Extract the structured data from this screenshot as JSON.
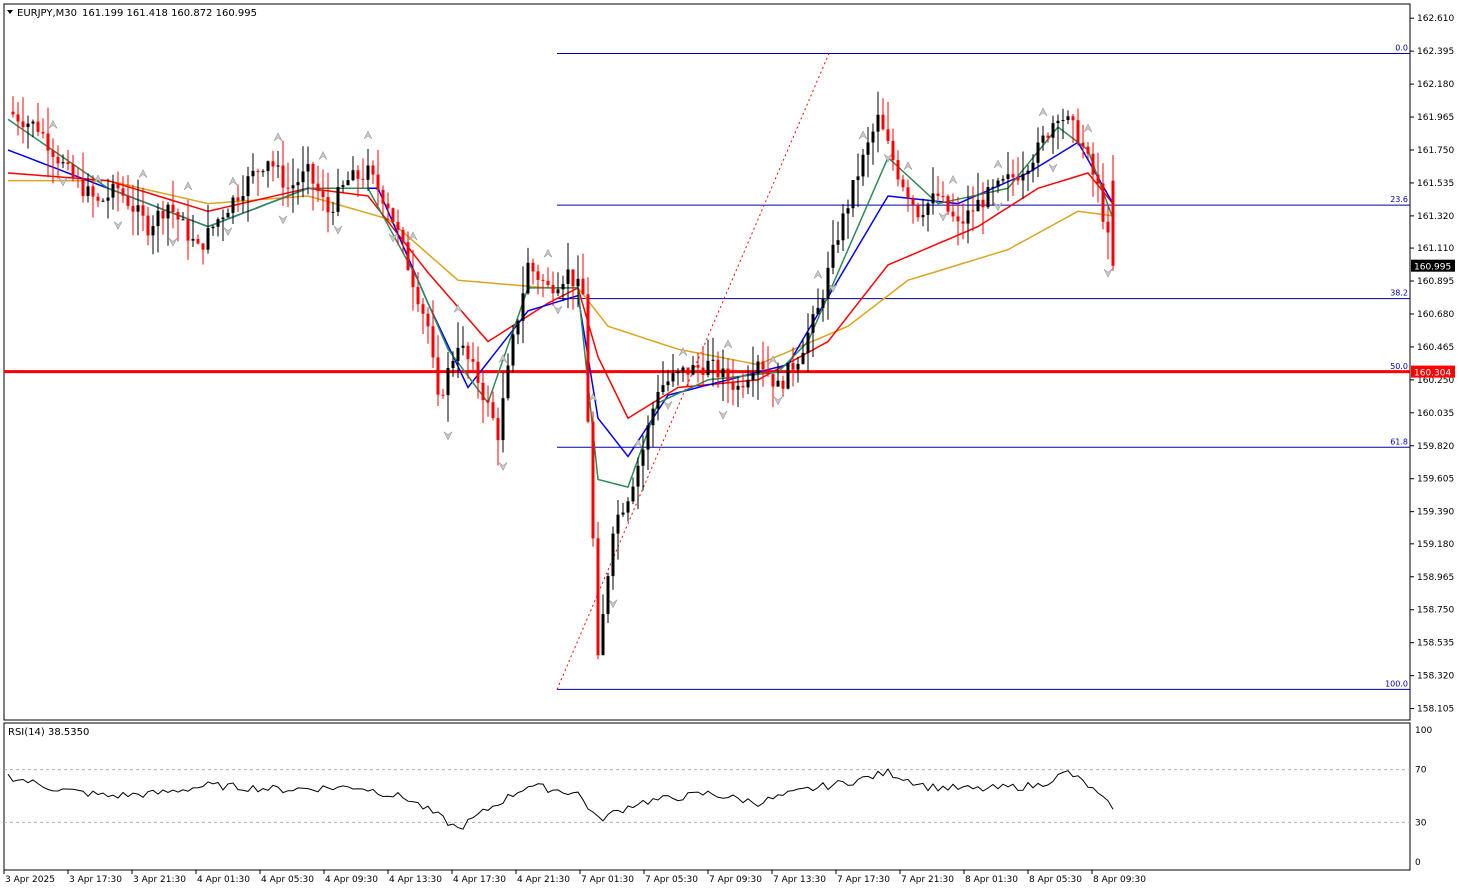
{
  "header": {
    "symbol": "EURJPY,M30",
    "ohlc": "161.199 161.418 160.872 160.995"
  },
  "price_axis": {
    "ticks": [
      "162.610",
      "162.395",
      "162.180",
      "161.965",
      "161.750",
      "161.535",
      "161.320",
      "161.110",
      "160.895",
      "160.680",
      "160.465",
      "160.250",
      "160.035",
      "159.820",
      "159.605",
      "159.390",
      "159.180",
      "158.965",
      "158.750",
      "158.535",
      "158.320",
      "158.105"
    ],
    "current_price_label": "160.995",
    "horizontal_line_label": "160.304"
  },
  "fibonacci": {
    "levels": [
      {
        "label": "0.0",
        "price": 162.38
      },
      {
        "label": "23.6",
        "price": 161.39
      },
      {
        "label": "38.2",
        "price": 160.78
      },
      {
        "label": "50.0",
        "price": 160.3
      },
      {
        "label": "61.8",
        "price": 159.81
      },
      {
        "label": "100.0",
        "price": 158.23
      }
    ]
  },
  "time_axis": {
    "labels": [
      "3 Apr 2025",
      "3 Apr 17:30",
      "3 Apr 21:30",
      "4 Apr 01:30",
      "4 Apr 05:30",
      "4 Apr 09:30",
      "4 Apr 13:30",
      "4 Apr 17:30",
      "4 Apr 21:30",
      "7 Apr 01:30",
      "7 Apr 05:30",
      "7 Apr 09:30",
      "7 Apr 13:30",
      "7 Apr 17:30",
      "7 Apr 21:30",
      "8 Apr 01:30",
      "8 Apr 05:30",
      "8 Apr 09:30"
    ]
  },
  "rsi": {
    "label": "RSI(14) 38.5350",
    "levels": [
      "100",
      "70",
      "30",
      "0"
    ]
  },
  "colors": {
    "bull": "#000000",
    "bear": "#ff0000",
    "ma_fast": "#2e8b57",
    "ma_blue": "#0000ff",
    "ma_red": "#ff0000",
    "ma_gold": "#daa520",
    "fib": "#0000aa",
    "hline": "#ff0000"
  },
  "chart_data": {
    "type": "candlestick",
    "symbol": "EURJPY",
    "timeframe": "M30",
    "ylim": [
      158.05,
      162.72
    ],
    "close_points": [
      [
        0,
        162.0
      ],
      [
        6,
        161.9
      ],
      [
        12,
        161.6
      ],
      [
        18,
        161.4
      ],
      [
        22,
        161.5
      ],
      [
        28,
        161.25
      ],
      [
        32,
        161.4
      ],
      [
        38,
        161.1
      ],
      [
        42,
        161.3
      ],
      [
        48,
        161.55
      ],
      [
        52,
        161.7
      ],
      [
        56,
        161.5
      ],
      [
        60,
        161.6
      ],
      [
        64,
        161.35
      ],
      [
        68,
        161.55
      ],
      [
        72,
        161.6
      ],
      [
        76,
        161.4
      ],
      [
        80,
        161.0
      ],
      [
        84,
        160.6
      ],
      [
        86,
        160.1
      ],
      [
        90,
        160.5
      ],
      [
        94,
        160.25
      ],
      [
        98,
        159.9
      ],
      [
        101,
        160.5
      ],
      [
        104,
        161.0
      ],
      [
        108,
        160.85
      ],
      [
        112,
        160.95
      ],
      [
        115,
        160.8
      ],
      [
        118,
        158.4
      ],
      [
        121,
        159.3
      ],
      [
        124,
        159.5
      ],
      [
        127,
        159.8
      ],
      [
        130,
        160.2
      ],
      [
        135,
        160.3
      ],
      [
        140,
        160.35
      ],
      [
        146,
        160.2
      ],
      [
        150,
        160.4
      ],
      [
        154,
        160.2
      ],
      [
        158,
        160.4
      ],
      [
        162,
        160.7
      ],
      [
        166,
        161.2
      ],
      [
        170,
        161.6
      ],
      [
        174,
        161.95
      ],
      [
        178,
        161.6
      ],
      [
        182,
        161.35
      ],
      [
        186,
        161.45
      ],
      [
        190,
        161.25
      ],
      [
        194,
        161.4
      ],
      [
        198,
        161.5
      ],
      [
        202,
        161.6
      ],
      [
        206,
        161.75
      ],
      [
        210,
        162.0
      ],
      [
        214,
        161.85
      ],
      [
        218,
        161.5
      ],
      [
        221,
        160.99
      ]
    ],
    "ma_fast": [
      [
        0,
        161.95
      ],
      [
        20,
        161.5
      ],
      [
        40,
        161.25
      ],
      [
        60,
        161.5
      ],
      [
        72,
        161.5
      ],
      [
        82,
        160.9
      ],
      [
        88,
        160.45
      ],
      [
        96,
        160.1
      ],
      [
        104,
        160.85
      ],
      [
        114,
        160.85
      ],
      [
        118,
        159.6
      ],
      [
        124,
        159.55
      ],
      [
        130,
        160.1
      ],
      [
        140,
        160.25
      ],
      [
        154,
        160.3
      ],
      [
        160,
        160.5
      ],
      [
        168,
        161.1
      ],
      [
        176,
        161.7
      ],
      [
        186,
        161.4
      ],
      [
        200,
        161.5
      ],
      [
        210,
        161.9
      ],
      [
        216,
        161.75
      ],
      [
        221,
        161.3
      ]
    ],
    "ma_blue": [
      [
        0,
        161.75
      ],
      [
        20,
        161.5
      ],
      [
        40,
        161.25
      ],
      [
        60,
        161.5
      ],
      [
        74,
        161.5
      ],
      [
        84,
        160.75
      ],
      [
        92,
        160.2
      ],
      [
        104,
        160.7
      ],
      [
        114,
        160.8
      ],
      [
        118,
        160.0
      ],
      [
        124,
        159.75
      ],
      [
        132,
        160.15
      ],
      [
        144,
        160.25
      ],
      [
        156,
        160.35
      ],
      [
        166,
        160.9
      ],
      [
        176,
        161.45
      ],
      [
        190,
        161.4
      ],
      [
        204,
        161.6
      ],
      [
        214,
        161.8
      ],
      [
        221,
        161.4
      ]
    ],
    "ma_red": [
      [
        0,
        161.6
      ],
      [
        20,
        161.55
      ],
      [
        40,
        161.35
      ],
      [
        60,
        161.5
      ],
      [
        72,
        161.45
      ],
      [
        84,
        160.95
      ],
      [
        96,
        160.5
      ],
      [
        108,
        160.75
      ],
      [
        114,
        160.85
      ],
      [
        118,
        160.4
      ],
      [
        124,
        160.0
      ],
      [
        134,
        160.2
      ],
      [
        150,
        160.25
      ],
      [
        164,
        160.5
      ],
      [
        176,
        161.0
      ],
      [
        194,
        161.25
      ],
      [
        206,
        161.5
      ],
      [
        216,
        161.6
      ],
      [
        221,
        161.4
      ]
    ],
    "ma_gold": [
      [
        0,
        161.55
      ],
      [
        20,
        161.55
      ],
      [
        40,
        161.4
      ],
      [
        60,
        161.45
      ],
      [
        76,
        161.3
      ],
      [
        90,
        160.9
      ],
      [
        108,
        160.85
      ],
      [
        114,
        160.85
      ],
      [
        120,
        160.6
      ],
      [
        134,
        160.45
      ],
      [
        150,
        160.35
      ],
      [
        168,
        160.6
      ],
      [
        180,
        160.9
      ],
      [
        200,
        161.1
      ],
      [
        214,
        161.35
      ],
      [
        221,
        161.32
      ]
    ],
    "rsi_points": [
      [
        0,
        65
      ],
      [
        10,
        55
      ],
      [
        20,
        50
      ],
      [
        30,
        52
      ],
      [
        40,
        58
      ],
      [
        55,
        55
      ],
      [
        70,
        57
      ],
      [
        80,
        48
      ],
      [
        86,
        35
      ],
      [
        90,
        25
      ],
      [
        96,
        40
      ],
      [
        104,
        58
      ],
      [
        114,
        52
      ],
      [
        118,
        32
      ],
      [
        126,
        45
      ],
      [
        140,
        52
      ],
      [
        150,
        45
      ],
      [
        160,
        55
      ],
      [
        170,
        62
      ],
      [
        176,
        68
      ],
      [
        184,
        57
      ],
      [
        194,
        55
      ],
      [
        206,
        58
      ],
      [
        212,
        68
      ],
      [
        216,
        58
      ],
      [
        221,
        40
      ]
    ]
  }
}
